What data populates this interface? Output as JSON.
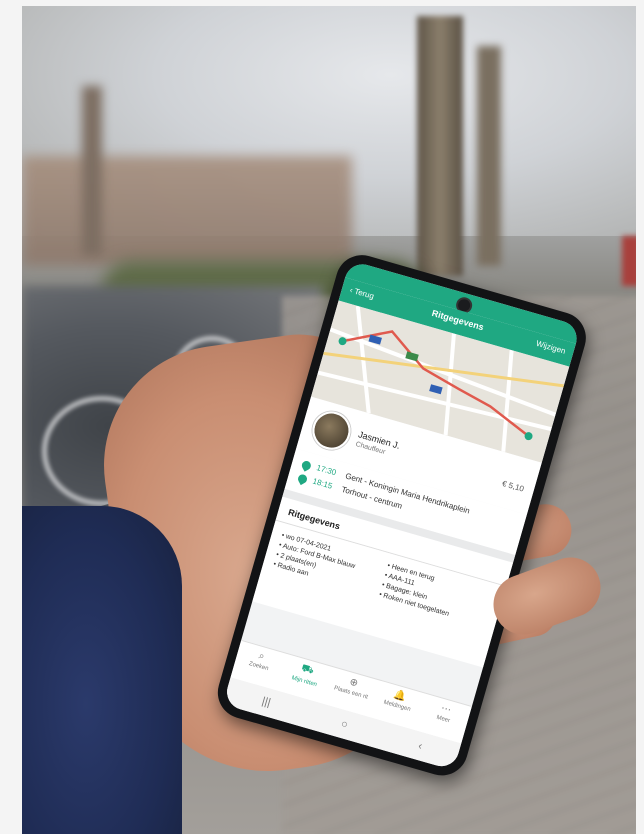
{
  "app": {
    "back_label": "‹ Terug",
    "screen_title": "Ritgegevens",
    "edit_label": "Wijzigen"
  },
  "driver": {
    "name": "Jasmien J.",
    "role": "Chauffeur",
    "price": "€ 5,10"
  },
  "stops": [
    {
      "time": "17:30",
      "place": "Gent - Koningin Maria Hendrikaplein"
    },
    {
      "time": "18:15",
      "place": "Torhout - centrum"
    }
  ],
  "details": {
    "title": "Ritgegevens",
    "left": [
      "• wo 07-04-2021",
      "• Auto: Ford B-Max blauw",
      "• 2 plaats(en)",
      "• Radio aan"
    ],
    "right": [
      "• Heen en terug",
      "• AAA-111",
      "• Bagage: klein",
      "• Roken niet toegelaten"
    ]
  },
  "tabs": [
    {
      "icon": "⌕",
      "label": "Zoeken"
    },
    {
      "icon": "⛟",
      "label": "Mijn ritten"
    },
    {
      "icon": "⊕",
      "label": "Plaats een rit"
    },
    {
      "icon": "🔔",
      "label": "Meldingen"
    },
    {
      "icon": "⋯",
      "label": "Meer"
    }
  ],
  "navbar": {
    "recent": "|||",
    "home": "○",
    "back": "‹"
  },
  "map": {
    "route_color": "#e05a4e",
    "pin_color": "#1fa882",
    "road_label_color": "#2f5fb3"
  },
  "colors": {
    "accent": "#1fa882"
  }
}
